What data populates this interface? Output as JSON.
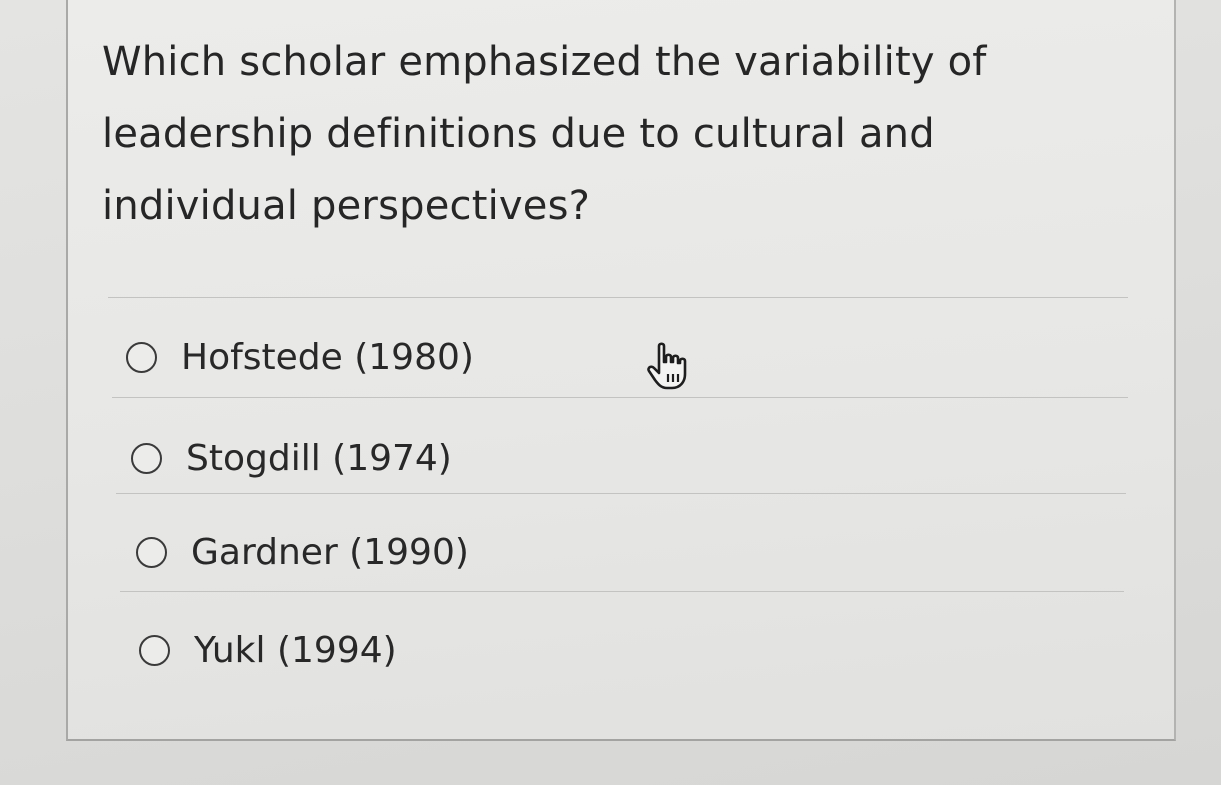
{
  "question": {
    "text": "Which scholar emphasized the variability of leadership definitions due to cultural and individual perspectives?"
  },
  "options": [
    {
      "label": "Hofstede (1980)"
    },
    {
      "label": "Stogdill (1974)"
    },
    {
      "label": "Gardner (1990)"
    },
    {
      "label": "Yukl (1994)"
    }
  ],
  "icons": {
    "cursor": "hand-pointer-icon"
  }
}
